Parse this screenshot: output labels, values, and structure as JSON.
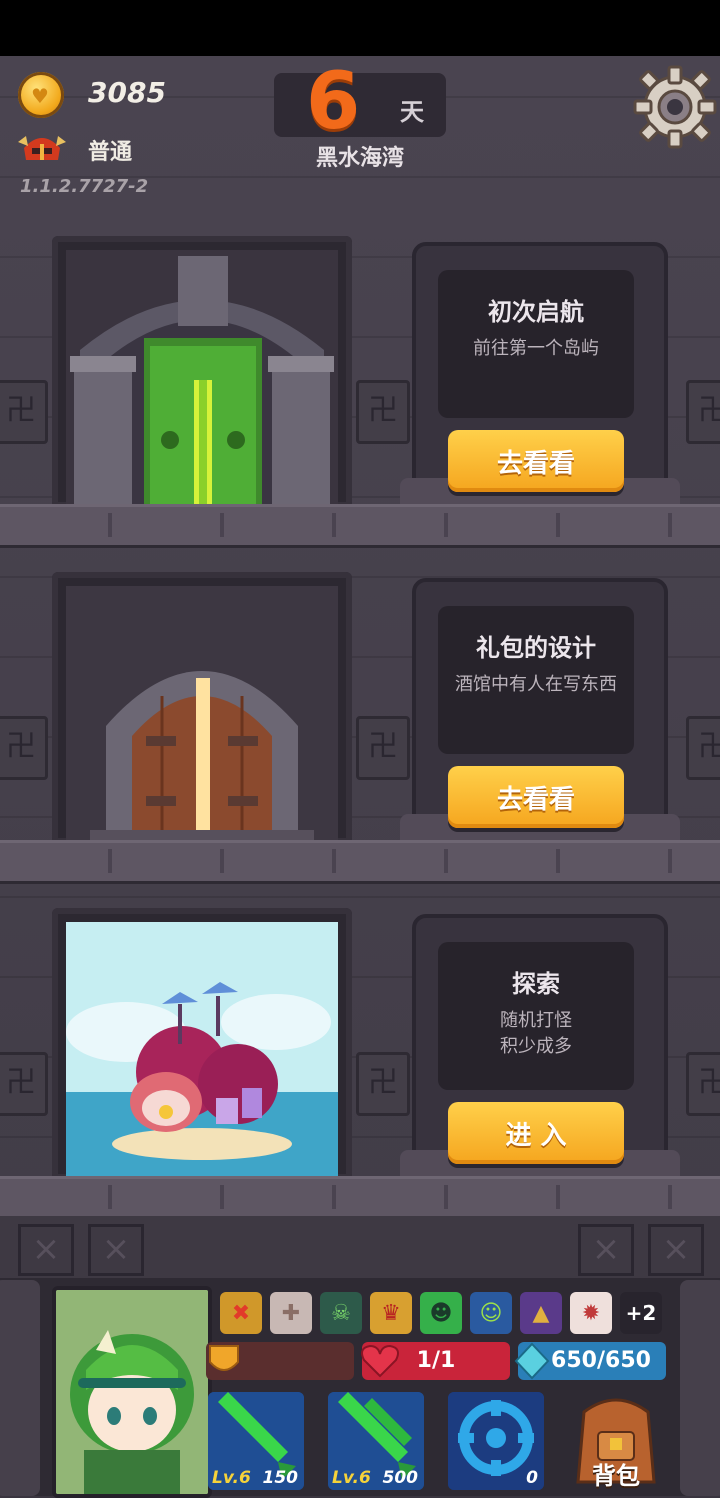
{
  "hud": {
    "coins": "3085",
    "difficulty": "普通",
    "version": "1.1.2.7727-2",
    "day_number": "6",
    "day_unit": "天",
    "location": "黑水海湾"
  },
  "rows": [
    {
      "title": "初次启航",
      "desc": "前往第一个岛屿",
      "button": "去看看",
      "art": "green-vault-door"
    },
    {
      "title": "礼包的设计",
      "desc": "酒馆中有人在写东西",
      "button": "去看看",
      "art": "wooden-arch-door"
    },
    {
      "title": "探索",
      "desc": "随机打怪\n积少成多",
      "button": "进 入",
      "art": "coral-island"
    }
  ],
  "status": {
    "effects": [
      "red-x-shield-icon",
      "cross-medal-icon",
      "green-zombie-icon",
      "crown-shield-icon",
      "green-slime-icon",
      "blue-monster-icon",
      "wizard-hat-icon",
      "eye-talisman-icon"
    ],
    "more_effects": "+2",
    "hp": "1/1",
    "mana": "650/650"
  },
  "skills": [
    {
      "level": "Lv.6",
      "cost": "150"
    },
    {
      "level": "Lv.6",
      "cost": "500"
    },
    {
      "level": "",
      "cost": "0"
    }
  ],
  "backpack_label": "背包",
  "colors": {
    "accent_orange": "#f26a1a",
    "button_yellow": "#f5a51e",
    "hp_red": "#c9243a",
    "mana_blue": "#2a7fb8"
  }
}
